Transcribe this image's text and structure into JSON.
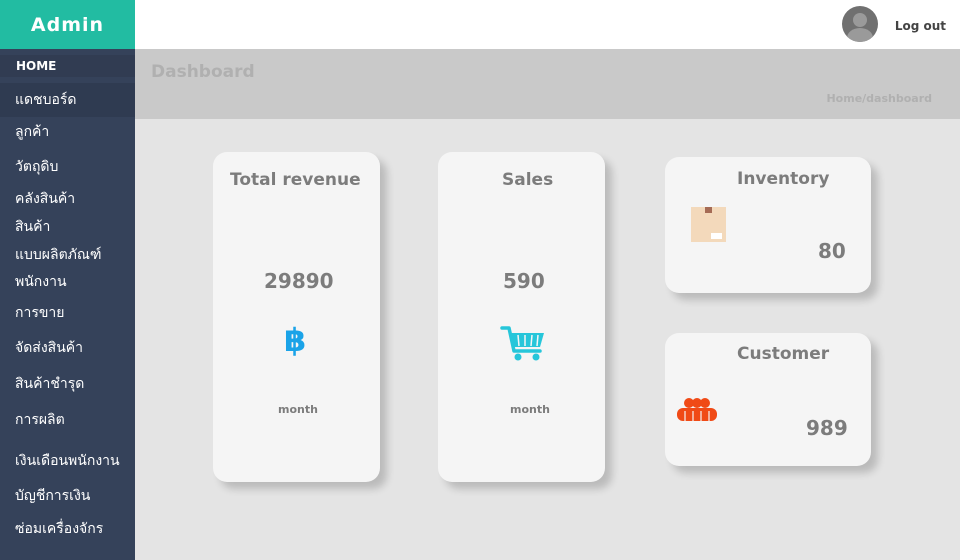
{
  "app": {
    "title": "Admin"
  },
  "topbar": {
    "logout_label": "Log out",
    "avatar_icon": "user-avatar-icon"
  },
  "sidebar": {
    "section_label": "HOME",
    "items": [
      {
        "label": "แดชบอร์ด",
        "active": true
      },
      {
        "label": "ลูกค้า"
      },
      {
        "label": "วัตถุดิบ"
      },
      {
        "label": "คลังสินค้า"
      },
      {
        "label": "สินค้า"
      },
      {
        "label": "แบบผลิตภัณฑ์"
      },
      {
        "label": "พนักงาน"
      },
      {
        "label": "การขาย"
      },
      {
        "label": "จัดส่งสินค้า"
      },
      {
        "label": "สินค้าชำรุด"
      },
      {
        "label": "การผลิต"
      },
      {
        "label": "เงินเดือนพนักงาน"
      },
      {
        "label": "บัญชีการเงิน"
      },
      {
        "label": "ซ่อมเครื่องจักร"
      }
    ]
  },
  "header": {
    "title": "Dashboard",
    "breadcrumb": "Home/dashboard"
  },
  "cards": {
    "revenue": {
      "title": "Total revenue",
      "value": "29890",
      "icon_glyph": "฿",
      "icon": "baht-icon",
      "sub": "month",
      "icon_color": "#1aa3e8"
    },
    "sales": {
      "title": "Sales",
      "value": "590",
      "icon": "shopping-cart-icon",
      "sub": "month",
      "icon_color": "#26c6da"
    },
    "inventory": {
      "title": "Inventory",
      "value": "80",
      "icon": "box-icon"
    },
    "customer": {
      "title": "Customer",
      "value": "989",
      "icon": "people-group-icon",
      "icon_color": "#f04a16"
    }
  },
  "colors": {
    "brand": "#22bca2",
    "sidebar": "#35425a",
    "header": "#c9c9c9"
  }
}
